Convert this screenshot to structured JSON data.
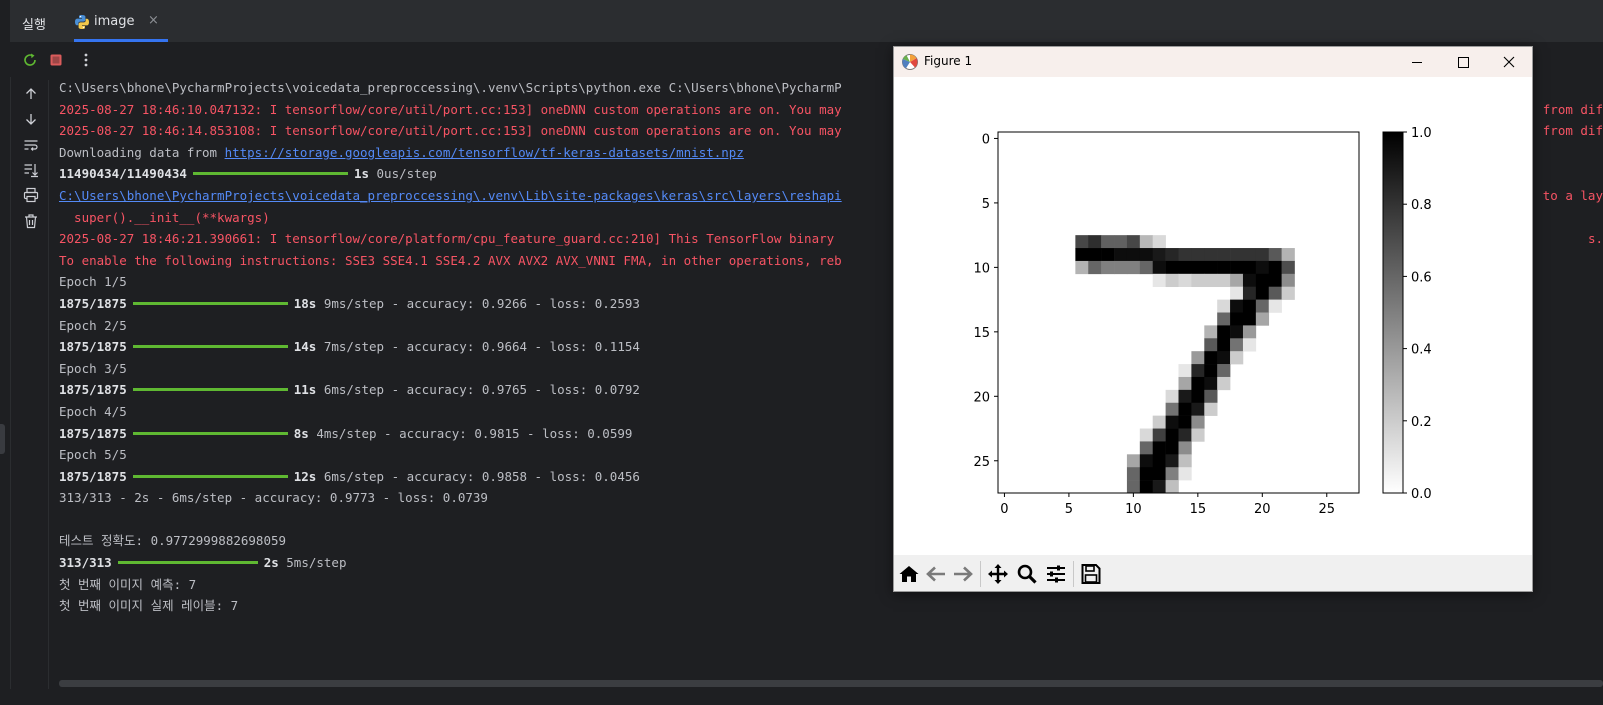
{
  "tabbar": {
    "run_label": "실행",
    "tab_name": "image",
    "close_glyph": "×"
  },
  "console": {
    "lines": [
      {
        "parts": [
          {
            "t": "C:\\Users\\bhone\\PycharmProjects\\voicedata_preproccessing\\.venv\\Scripts\\python.exe C:\\Users\\bhone\\PycharmP"
          }
        ]
      },
      {
        "parts": [
          {
            "t": "2025-08-27 18:46:10.047132: I tensorflow/core/util/port.cc:153] oneDNN custom operations are on. You may",
            "c": "red"
          }
        ]
      },
      {
        "parts": [
          {
            "t": "2025-08-27 18:46:14.853108: I tensorflow/core/util/port.cc:153] oneDNN custom operations are on. You may",
            "c": "red"
          }
        ]
      },
      {
        "parts": [
          {
            "t": "Downloading data from "
          },
          {
            "t": "https://storage.googleapis.com/tensorflow/tf-keras-datasets/mnist.npz",
            "c": "link"
          }
        ]
      },
      {
        "parts": [
          {
            "t": "11490434/11490434",
            "c": "bold"
          },
          {
            "bar": 155
          },
          {
            "t": "1s",
            "c": "bold"
          },
          {
            "t": " 0us/step"
          }
        ]
      },
      {
        "parts": [
          {
            "t": "C:\\Users\\bhone\\PycharmProjects\\voicedata_preproccessing\\.venv\\Lib\\site-packages\\keras\\src\\layers\\reshapi",
            "c": "link"
          }
        ]
      },
      {
        "parts": [
          {
            "t": "  super().__init__(**kwargs)",
            "c": "red"
          }
        ]
      },
      {
        "parts": [
          {
            "t": "2025-08-27 18:46:21.390661: I tensorflow/core/platform/cpu_feature_guard.cc:210] This TensorFlow binary",
            "c": "red"
          }
        ]
      },
      {
        "parts": [
          {
            "t": "To enable the following instructions: SSE3 SSE4.1 SSE4.2 AVX AVX2 AVX_VNNI FMA, in other operations, reb",
            "c": "red"
          }
        ]
      },
      {
        "parts": [
          {
            "t": "Epoch 1/5"
          }
        ]
      },
      {
        "parts": [
          {
            "t": "1875/1875",
            "c": "bold"
          },
          {
            "bar": 155
          },
          {
            "t": "18s",
            "c": "bold"
          },
          {
            "t": " 9ms/step - accuracy: 0.9266 - loss: 0.2593"
          }
        ]
      },
      {
        "parts": [
          {
            "t": "Epoch 2/5"
          }
        ]
      },
      {
        "parts": [
          {
            "t": "1875/1875",
            "c": "bold"
          },
          {
            "bar": 155
          },
          {
            "t": "14s",
            "c": "bold"
          },
          {
            "t": " 7ms/step - accuracy: 0.9664 - loss: 0.1154"
          }
        ]
      },
      {
        "parts": [
          {
            "t": "Epoch 3/5"
          }
        ]
      },
      {
        "parts": [
          {
            "t": "1875/1875",
            "c": "bold"
          },
          {
            "bar": 155
          },
          {
            "t": "11s",
            "c": "bold"
          },
          {
            "t": " 6ms/step - accuracy: 0.9765 - loss: 0.0792"
          }
        ]
      },
      {
        "parts": [
          {
            "t": "Epoch 4/5"
          }
        ]
      },
      {
        "parts": [
          {
            "t": "1875/1875",
            "c": "bold"
          },
          {
            "bar": 155
          },
          {
            "t": "8s",
            "c": "bold"
          },
          {
            "t": " 4ms/step - accuracy: 0.9815 - loss: 0.0599"
          }
        ]
      },
      {
        "parts": [
          {
            "t": "Epoch 5/5"
          }
        ]
      },
      {
        "parts": [
          {
            "t": "1875/1875",
            "c": "bold"
          },
          {
            "bar": 155
          },
          {
            "t": "12s",
            "c": "bold"
          },
          {
            "t": " 6ms/step - accuracy: 0.9858 - loss: 0.0456"
          }
        ]
      },
      {
        "parts": [
          {
            "t": "313/313 - 2s - 6ms/step - accuracy: 0.9773 - loss: 0.0739"
          }
        ]
      },
      {
        "parts": [
          {
            "t": ""
          }
        ]
      },
      {
        "parts": [
          {
            "t": "테스트 정확도: 0.9772999882698059"
          }
        ]
      },
      {
        "parts": [
          {
            "t": "313/313",
            "c": "bold"
          },
          {
            "bar": 140
          },
          {
            "t": "2s",
            "c": "bold"
          },
          {
            "t": " 5ms/step"
          }
        ]
      },
      {
        "parts": [
          {
            "t": "첫 번째 이미지 예측: 7"
          }
        ]
      },
      {
        "parts": [
          {
            "t": "첫 번째 이미지 실제 레이블: 7"
          }
        ]
      }
    ],
    "right_overflow": [
      {
        "row": 1,
        "t": "from dif",
        "c": "red"
      },
      {
        "row": 2,
        "t": "from dif",
        "c": "red"
      },
      {
        "row": 5,
        "t": "to a lay",
        "c": "red"
      },
      {
        "row": 7,
        "t": "s.",
        "c": "red"
      }
    ]
  },
  "figure": {
    "title": "Figure 1",
    "image": {
      "rows": 28,
      "cols": 28,
      "cmap": "gray_r",
      "pixels": [
        [
          8,
          6,
          0.72
        ],
        [
          8,
          7,
          0.82
        ],
        [
          8,
          8,
          0.62
        ],
        [
          8,
          9,
          0.62
        ],
        [
          8,
          10,
          0.72
        ],
        [
          8,
          11,
          0.28
        ],
        [
          8,
          12,
          0.15
        ],
        [
          9,
          6,
          1
        ],
        [
          9,
          7,
          1
        ],
        [
          9,
          8,
          1
        ],
        [
          9,
          9,
          0.95
        ],
        [
          9,
          10,
          0.95
        ],
        [
          9,
          11,
          0.95
        ],
        [
          9,
          12,
          0.9
        ],
        [
          9,
          13,
          0.85
        ],
        [
          9,
          14,
          0.8
        ],
        [
          9,
          15,
          0.8
        ],
        [
          9,
          16,
          0.8
        ],
        [
          9,
          17,
          0.8
        ],
        [
          9,
          18,
          0.8
        ],
        [
          9,
          19,
          0.8
        ],
        [
          9,
          20,
          0.8
        ],
        [
          9,
          21,
          0.65
        ],
        [
          9,
          22,
          0.3
        ],
        [
          10,
          6,
          0.3
        ],
        [
          10,
          7,
          0.6
        ],
        [
          10,
          8,
          0.5
        ],
        [
          10,
          9,
          0.5
        ],
        [
          10,
          10,
          0.5
        ],
        [
          10,
          11,
          0.6
        ],
        [
          10,
          12,
          0.95
        ],
        [
          10,
          13,
          1
        ],
        [
          10,
          14,
          1
        ],
        [
          10,
          15,
          1
        ],
        [
          10,
          16,
          1
        ],
        [
          10,
          17,
          1
        ],
        [
          10,
          18,
          1
        ],
        [
          10,
          19,
          1
        ],
        [
          10,
          20,
          0.95
        ],
        [
          10,
          21,
          1
        ],
        [
          10,
          22,
          0.7
        ],
        [
          11,
          12,
          0.1
        ],
        [
          11,
          13,
          0.2
        ],
        [
          11,
          14,
          0.15
        ],
        [
          11,
          15,
          0.2
        ],
        [
          11,
          16,
          0.2
        ],
        [
          11,
          17,
          0.2
        ],
        [
          11,
          18,
          0.35
        ],
        [
          11,
          19,
          0.95
        ],
        [
          11,
          20,
          1
        ],
        [
          11,
          21,
          1
        ],
        [
          11,
          22,
          0.45
        ],
        [
          12,
          18,
          0.1
        ],
        [
          12,
          19,
          0.85
        ],
        [
          12,
          20,
          1
        ],
        [
          12,
          21,
          0.65
        ],
        [
          12,
          22,
          0.2
        ],
        [
          13,
          17,
          0.15
        ],
        [
          13,
          18,
          0.95
        ],
        [
          13,
          19,
          1
        ],
        [
          13,
          20,
          0.6
        ],
        [
          13,
          21,
          0.1
        ],
        [
          14,
          17,
          0.6
        ],
        [
          14,
          18,
          1
        ],
        [
          14,
          19,
          1
        ],
        [
          14,
          20,
          0.35
        ],
        [
          15,
          16,
          0.3
        ],
        [
          15,
          17,
          1
        ],
        [
          15,
          18,
          0.95
        ],
        [
          15,
          19,
          0.4
        ],
        [
          16,
          16,
          0.65
        ],
        [
          16,
          17,
          1
        ],
        [
          16,
          18,
          0.55
        ],
        [
          16,
          19,
          0.1
        ],
        [
          17,
          15,
          0.4
        ],
        [
          17,
          16,
          1
        ],
        [
          17,
          17,
          0.95
        ],
        [
          17,
          18,
          0.2
        ],
        [
          18,
          14,
          0.1
        ],
        [
          18,
          15,
          0.85
        ],
        [
          18,
          16,
          1
        ],
        [
          18,
          17,
          0.6
        ],
        [
          19,
          14,
          0.35
        ],
        [
          19,
          15,
          1
        ],
        [
          19,
          16,
          0.95
        ],
        [
          19,
          17,
          0.2
        ],
        [
          20,
          13,
          0.15
        ],
        [
          20,
          14,
          0.9
        ],
        [
          20,
          15,
          1
        ],
        [
          20,
          16,
          0.65
        ],
        [
          21,
          13,
          0.55
        ],
        [
          21,
          14,
          1
        ],
        [
          21,
          15,
          0.9
        ],
        [
          21,
          16,
          0.2
        ],
        [
          22,
          12,
          0.2
        ],
        [
          22,
          13,
          0.95
        ],
        [
          22,
          14,
          1
        ],
        [
          22,
          15,
          0.45
        ],
        [
          23,
          11,
          0.15
        ],
        [
          23,
          12,
          0.75
        ],
        [
          23,
          13,
          1
        ],
        [
          23,
          14,
          0.85
        ],
        [
          23,
          15,
          0.2
        ],
        [
          24,
          11,
          0.6
        ],
        [
          24,
          12,
          1
        ],
        [
          24,
          13,
          1
        ],
        [
          24,
          14,
          0.45
        ],
        [
          25,
          10,
          0.35
        ],
        [
          25,
          11,
          0.95
        ],
        [
          25,
          12,
          1
        ],
        [
          25,
          13,
          0.9
        ],
        [
          25,
          14,
          0.25
        ],
        [
          26,
          10,
          0.6
        ],
        [
          26,
          11,
          1
        ],
        [
          26,
          12,
          1
        ],
        [
          26,
          13,
          0.5
        ],
        [
          26,
          14,
          0.1
        ],
        [
          27,
          10,
          0.6
        ],
        [
          27,
          11,
          1
        ],
        [
          27,
          12,
          0.9
        ],
        [
          27,
          13,
          0.25
        ]
      ]
    },
    "x_ticks": [
      "0",
      "5",
      "10",
      "15",
      "20",
      "25"
    ],
    "y_ticks": [
      "0",
      "5",
      "10",
      "15",
      "20",
      "25"
    ],
    "colorbar_ticks": [
      "1.0",
      "0.8",
      "0.6",
      "0.4",
      "0.2",
      "0.0"
    ],
    "colorbar_range": [
      0,
      1
    ]
  },
  "icons": {
    "tab": "python-file-icon",
    "rerun": "rerun-icon",
    "stop": "stop-icon",
    "more": "more-vertical-icon",
    "side": [
      "scroll-up-icon",
      "scroll-down-icon",
      "soft-wrap-icon",
      "scroll-to-end-icon",
      "print-icon",
      "trash-icon"
    ],
    "figure_tools": [
      "home-icon",
      "back-icon",
      "forward-icon",
      "pan-icon",
      "zoom-icon",
      "configure-subplots-icon",
      "save-icon"
    ]
  },
  "colors": {
    "console_bg": "#1e1f22",
    "error": "#f75464",
    "link": "#548af7",
    "progress": "#5fb832",
    "stop": "#db5c5c"
  }
}
